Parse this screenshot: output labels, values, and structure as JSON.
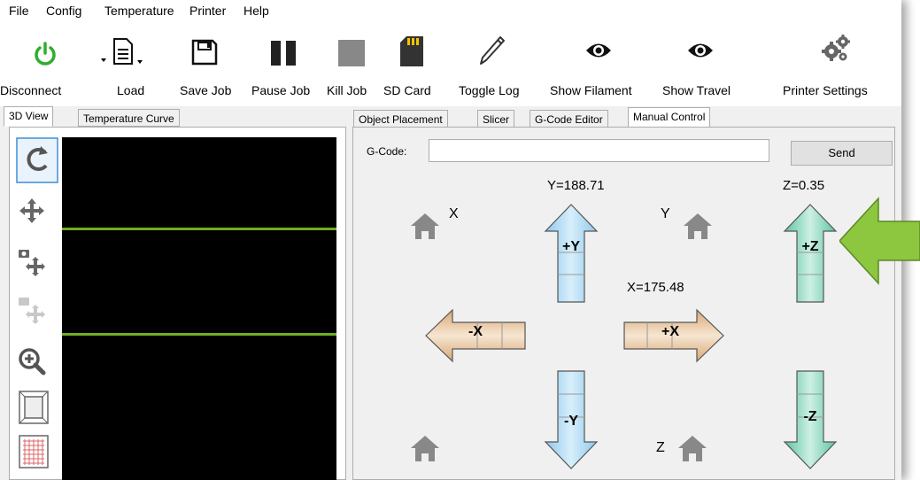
{
  "menu": [
    "File",
    "Config",
    "Temperature",
    "Printer",
    "Help"
  ],
  "toolbar": {
    "disconnect": "Disconnect",
    "load": "Load",
    "save_job": "Save Job",
    "pause_job": "Pause Job",
    "kill_job": "Kill Job",
    "sd_card": "SD Card",
    "toggle_log": "Toggle Log",
    "show_filament": "Show Filament",
    "show_travel": "Show Travel",
    "printer_settings": "Printer Settings"
  },
  "left_tabs": [
    "3D View",
    "Temperature Curve"
  ],
  "right_tabs": [
    "Object Placement",
    "Slicer",
    "G-Code Editor",
    "Manual Control"
  ],
  "manual": {
    "gcode_label": "G-Code:",
    "gcode_value": "",
    "send": "Send",
    "y_pos": "Y=188.71",
    "x_pos": "X=175.48",
    "z_pos": "Z=0.35",
    "home_x": "X",
    "home_y": "Y",
    "home_z": "Z",
    "plus_y": "+Y",
    "minus_y": "-Y",
    "plus_x": "+X",
    "minus_x": "-X",
    "plus_z": "+Z",
    "minus_z": "-Z"
  },
  "colors": {
    "viewport": "#000000",
    "model_line": "#6fae21",
    "y_arrow": "#b4dcf2",
    "x_arrow": "#e9cba7",
    "z_arrow": "#8fdbc3",
    "callout": "#8dc63f",
    "power_icon": "#2eae2e"
  }
}
